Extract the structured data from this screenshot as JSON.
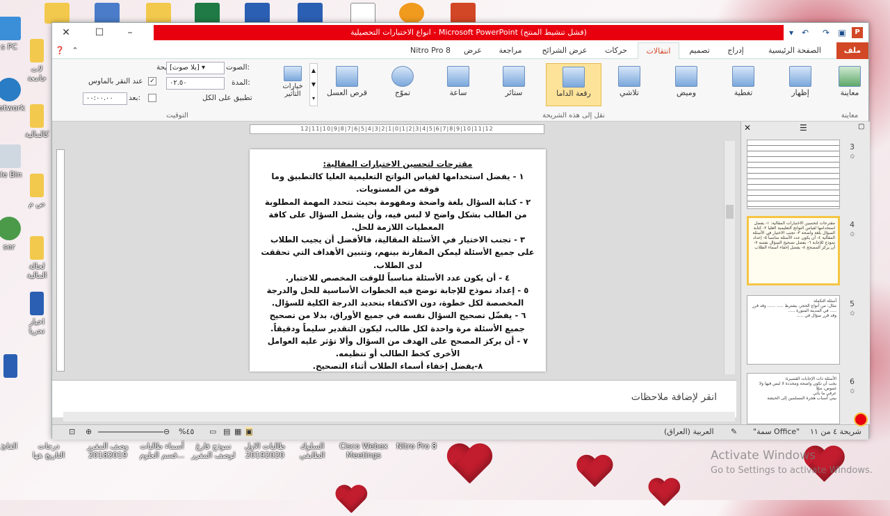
{
  "desktop": {
    "left_labels": [
      "s PC",
      "Network",
      "cle Bin",
      "ser"
    ],
    "left_partial": [
      "لات جامعة",
      "كالمالية",
      "ص\nم",
      "لحالة المالية",
      "اخبار تحريا"
    ],
    "bottom_labels": [
      "القائ",
      "درجات التاريخ هها",
      "وصف المقرر 20182019",
      "أسماء طالبات ...قسم العلوم",
      "نموذج فارغ لوصف المقرر",
      "طالبات الاول 20192020",
      "السلوك الطابقي",
      "Cisco Webex Meetings",
      "Nitro Pro 8"
    ]
  },
  "window": {
    "title": "انواع الاختبارات التحصيلية - Microsoft PowerPoint (فشل تنشيط المنتج)",
    "file_tab": "ملف",
    "tabs": [
      "الصفحة الرئيسية",
      "إدراج",
      "تصميم",
      "انتقالات",
      "حركات",
      "عرض الشرائح",
      "مراجعة",
      "عرض",
      "Nitro Pro 8"
    ],
    "active_tab": "انتقالات"
  },
  "ribbon": {
    "preview_label": "معاينة",
    "preview_group": "معاينة",
    "transitions": [
      "إظهار",
      "تغطية",
      "وميض",
      "تلاشي",
      "رقعة الداما",
      "ستائر",
      "ساعة",
      "تموّج",
      "قرص العسل"
    ],
    "selected_transition": "رقعة الداما",
    "effect_options": "خيارات التأثير",
    "transition_group": "نقل إلى هذه الشريحة",
    "sound_label": "الصوت:",
    "sound_value": "[بلا صوت]",
    "duration_label": "المدة:",
    "duration_value": "٠٢.٥٠",
    "apply_all": "تطبيق على الكل",
    "advance_label": "تقدم بالشريحة",
    "on_click": "عند النقر بالماوس",
    "after_label": "بعد:",
    "after_value": "٠٠:٠٠.٠٠",
    "timing_group": "التوقيت"
  },
  "ruler": "12|11|10|9|8|7|6|5|4|3|2|1|0|1|2|3|4|5|6|7|8|9|10|11|12",
  "slide": {
    "heading": "مقترحات لتحسين الاختبارات المقالية:",
    "lines": [
      "١ - يفضل استخدامها لقياس النواتج التعليمية العليا كالتطبيق وما فوقه من المستويات.",
      "٢ - كتابة السؤال بلغة واضحة ومفهومة بحيث تتحدد المهمة المطلوبة من الطالب بشكل واضح لا لبس فيه، وأن يشمل السؤال على كافة المعطيات اللازمة للحل.",
      "٣ - تجنب الاختيار في الأسئلة المقالية، فالأفضل أن يجيب الطلاب على جميع الأسئلة ليمكن المقارنة بينهم، وتتبين الأهداف التي تحققت لدى الطلاب.",
      "٤ - أن يكون عدد الأسئلة مناسباً للوقت المخصص للاختبار.",
      "٥ - إعداد نموذج للإجابة توضح فيه الخطوات الأساسية للحل والدرجة المخصصة لكل خطوة، دون الاكتفاء بتحديد الدرجة الكلية للسؤال.",
      "٦ - يفضّل تصحيح السؤال نفسه في جميع الأوراق، بدلا من تصحيح جميع الأسئلة مرة واحدة لكل طالب، ليكون التقدير سليماً ودقيقاً.",
      "٧ - أن يركز المصحح على الهدف من السؤال وألا تؤثر عليه العوامل الأخرى كخط الطالب أو تنظيمه.",
      "٨-يفضل إخفاء أسماء الطلاب أثناء التصحيح."
    ]
  },
  "notes_placeholder": "انقر لإضافة ملاحظات",
  "thumbnails": [
    {
      "num": "3",
      "text": ""
    },
    {
      "num": "4",
      "text": "مقترحات لتحسين الاختبارات المقالية: ١- يفضل استخدامها لقياس النواتج التعليمية العليا ٢- كتابة السؤال بلغة واضحة ٣- تجنب الاختيار في الأسئلة المقالية ٤- أن يكون عدد الأسئلة مناسباً ٥- إعداد نموذج للإجابة ٦- يفضل تصحيح السؤال نفسه ٧- أن يركز المصحح ٨- يفضل إخفاء أسماء الطلاب"
    },
    {
      "num": "5",
      "text": "أسئلة التكملة\nمثال: من أنواع الحجر، يشترط ..... ...... وقد قرر ..... في المدينة المنورة .....\nوقد قرر سؤال في ....."
    },
    {
      "num": "6",
      "text": "الأسئلة ذات الإجابات القصيرة:\nيجب أن تكون واضحة ومحددة لا لبس فيها ولا غموض، مثلا\nعرفي ما يأتي\nبيني أسباب هجرة المسلمين إلى الحبشة"
    }
  ],
  "status": {
    "slide_count": "شريحة ٤ من ١١",
    "theme": "\"سمة Office\"",
    "language": "العربية (العراق)",
    "zoom": "%٤٥"
  },
  "activate": {
    "line1": "Activate Windows",
    "line2": "Go to Settings to activate Windows."
  },
  "colors": {
    "title_bar": "#e8000e",
    "file_tab": "#d24726",
    "selected_button": "#fde39a"
  }
}
